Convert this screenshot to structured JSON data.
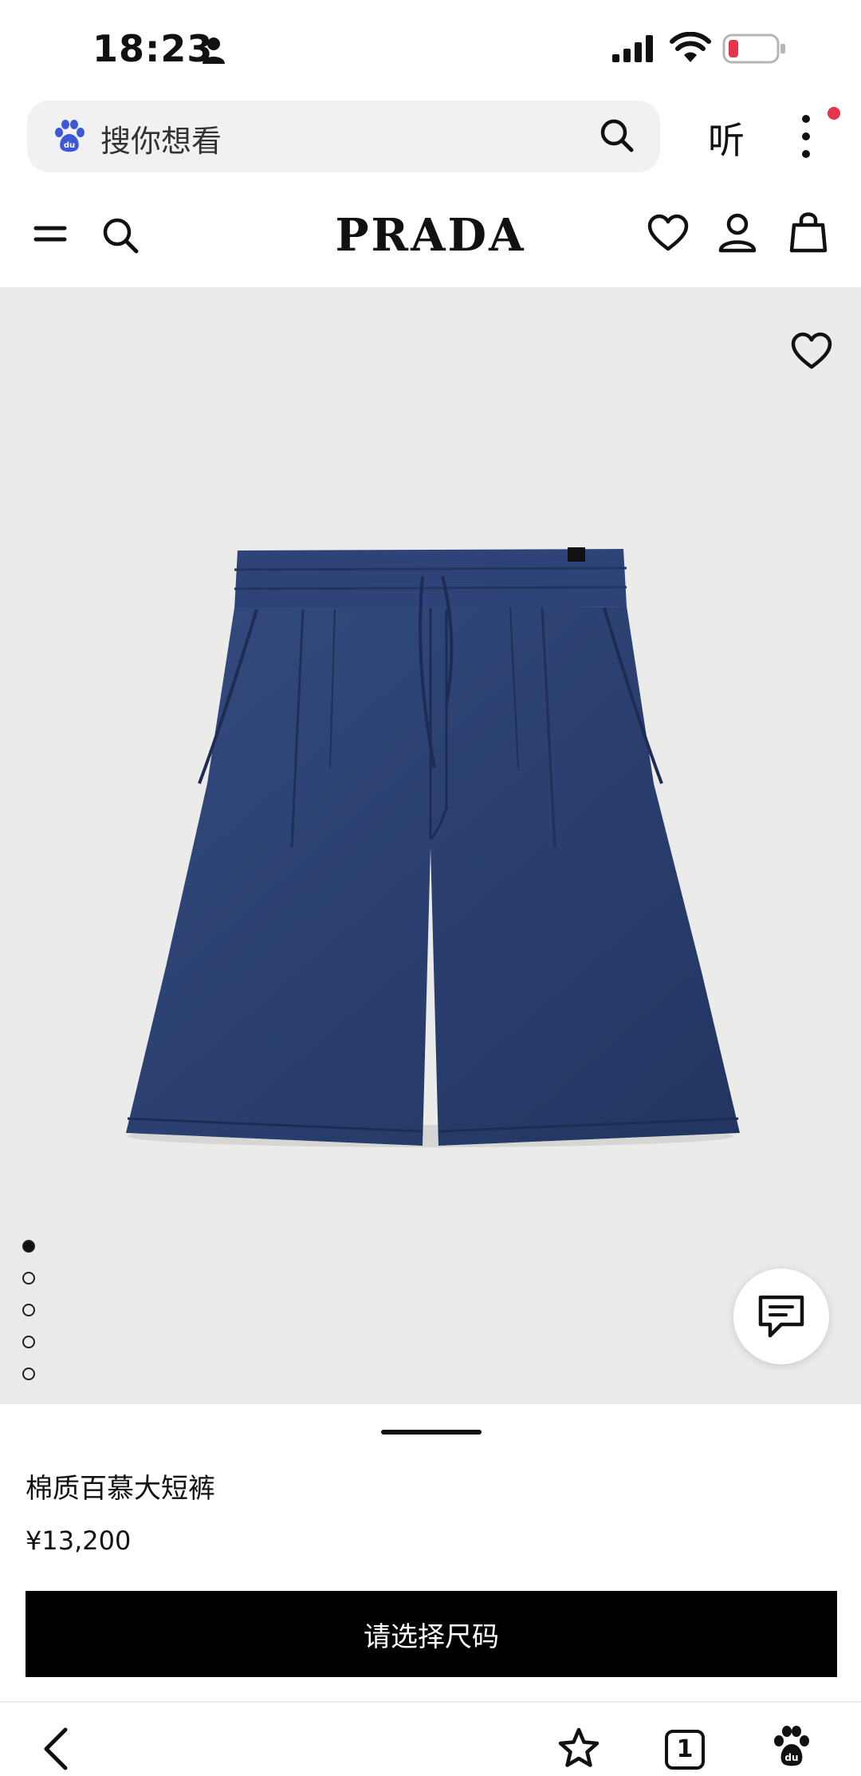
{
  "status_bar": {
    "time": "18:23"
  },
  "browser": {
    "search_placeholder": "搜你想看",
    "listen_label": "听"
  },
  "site": {
    "brand": "PRADA"
  },
  "product": {
    "name": "棉质百慕大短裤",
    "price": "¥13,200",
    "select_size_label": "请选择尺码",
    "color": "#2b3f6e",
    "image_count": 5,
    "current_image": 1
  },
  "tabs": {
    "count": "1"
  },
  "colors": {
    "accent": "#000000",
    "notification": "#e8344a",
    "battery_low": "#e8344a",
    "image_background": "#ebebea"
  }
}
